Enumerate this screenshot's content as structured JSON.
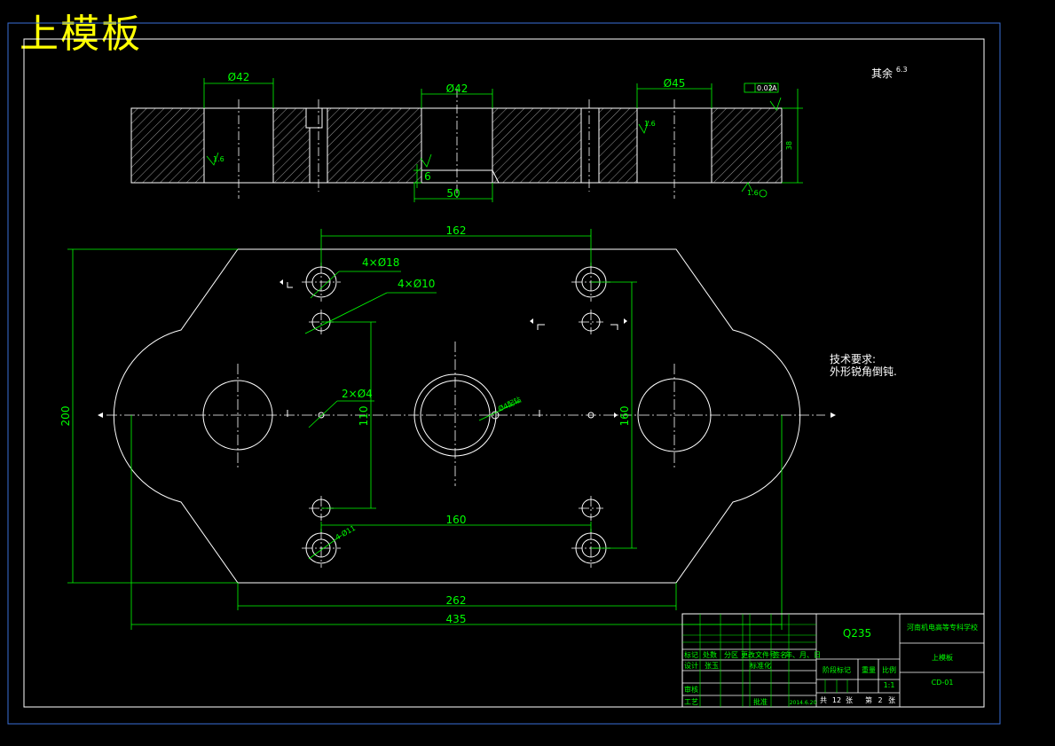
{
  "title": "上模板",
  "roughness_note": "其余",
  "roughness_value": "6.3",
  "tech": {
    "heading": "技术要求:",
    "line1": "外形锐角倒钝."
  },
  "section_dims": {
    "d42_left": "Ø42",
    "d42_mid": "Ø42",
    "d45": "Ø45",
    "w50": "50",
    "h6": "6",
    "h38": "38",
    "ra_left": "1.6",
    "ra_right": "1.6",
    "ra_bottom": "1.6",
    "flat_tol": "0.02",
    "flat_ref": "A"
  },
  "plan_dims": {
    "w162": "162",
    "w160": "160",
    "w262": "262",
    "w435": "435",
    "h200": "200",
    "h110": "110",
    "h160": "160",
    "holes_18": "4×Ø18",
    "holes_10": "4×Ø10",
    "holes_4": "2×Ø4",
    "center_note": "Ø4配钻",
    "pin_note": "4-Ø11"
  },
  "title_block": {
    "material": "Q235",
    "school": "河南机电高等专科学校",
    "part_name": "上模板",
    "drawing_no": "CD-01",
    "scale": "1:1",
    "headers": [
      "标记",
      "处数",
      "分区",
      "更改文件号",
      "签名",
      "年、月、日"
    ],
    "design_label": "设计",
    "designer": "张玉",
    "std_label": "标准化",
    "stage_label": "阶段标记",
    "weight_label": "重量",
    "scale_label": "比例",
    "review_label": "审核",
    "process_label": "工艺",
    "approve_label": "批准",
    "date": "2014.6.20",
    "sheets_total_label": "共",
    "sheets_total": "12",
    "sheets_unit": "张",
    "sheet_no_label": "第",
    "sheet_no": "2"
  }
}
